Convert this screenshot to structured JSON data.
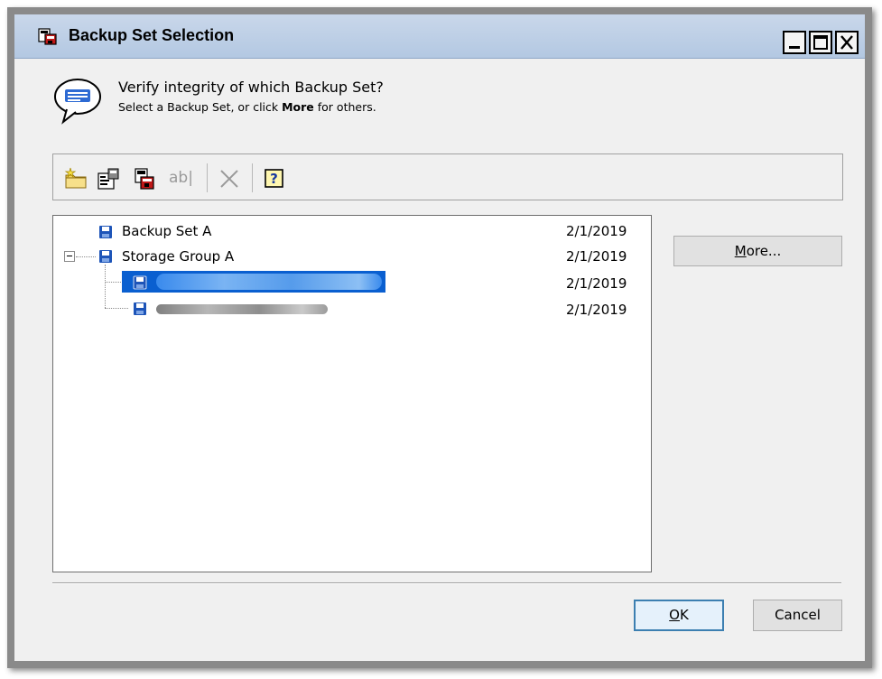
{
  "window": {
    "title": "Backup Set Selection"
  },
  "header": {
    "question": "Verify integrity of which Backup Set?",
    "hint_prefix": "Select a Backup Set, or click ",
    "hint_bold": "More",
    "hint_suffix": " for others."
  },
  "toolbar": {
    "items": [
      "new-folder-icon",
      "properties-icon",
      "delete-icon",
      "rename-icon",
      "close-icon",
      "help-icon"
    ],
    "rename_text": "ab|"
  },
  "tree": {
    "items": [
      {
        "label": "Backup Set A",
        "date": "2/1/2019"
      },
      {
        "label": "Storage Group A",
        "date": "2/1/2019",
        "expanded": true
      },
      {
        "label": "",
        "date": "2/1/2019",
        "selected": true
      },
      {
        "label": "",
        "date": "2/1/2019"
      }
    ],
    "expander": "⊟"
  },
  "buttons": {
    "more_accel": "M",
    "more_rest": "ore...",
    "ok_accel": "O",
    "ok_rest": "K",
    "cancel": "Cancel"
  },
  "colors": {
    "titlebar": "#b3c8e2",
    "selection": "#0a5fd0",
    "default_button_border": "#3c7fb1"
  }
}
